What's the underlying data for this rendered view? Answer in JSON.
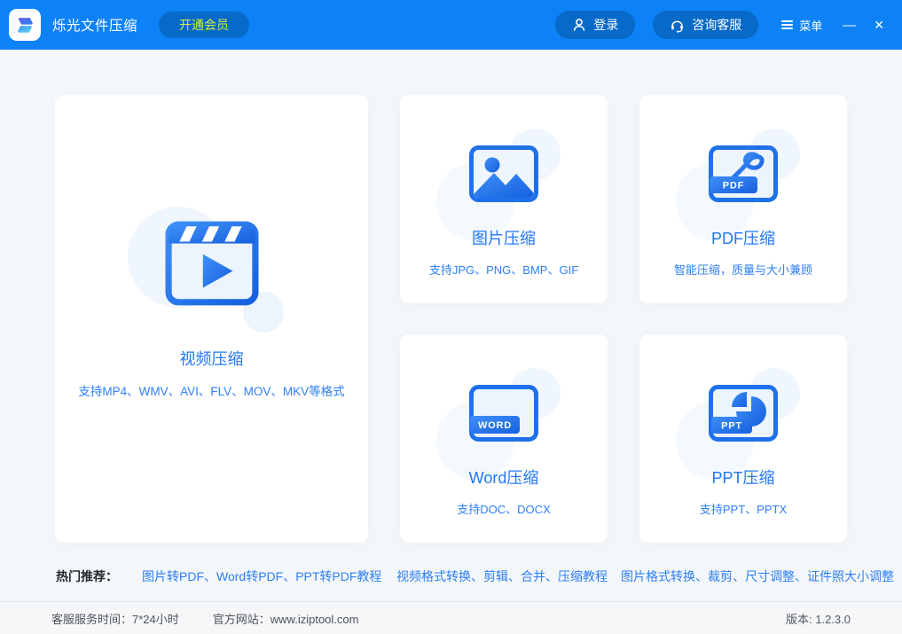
{
  "header": {
    "app_title": "烁光文件压缩",
    "vip_button_label": "开通会员",
    "login_button_label": "登录",
    "support_button_label": "咨询客服",
    "menu_label": "菜单",
    "minimize_glyph": "—",
    "close_glyph": "✕"
  },
  "cards": {
    "video": {
      "title": "视频压缩",
      "subtitle": "支持MP4、WMV、AVI、FLV、MOV、MKV等格式"
    },
    "image": {
      "title": "图片压缩",
      "subtitle": "支持JPG、PNG、BMP、GIF"
    },
    "pdf": {
      "title": "PDF压缩",
      "subtitle": "智能压缩，质量与大小兼顾",
      "badge": "PDF"
    },
    "word": {
      "title": "Word压缩",
      "subtitle": "支持DOC、DOCX",
      "badge": "WORD"
    },
    "ppt": {
      "title": "PPT压缩",
      "subtitle": "支持PPT、PPTX",
      "badge": "PPT"
    }
  },
  "recommendations": {
    "label": "热门推荐：",
    "links": [
      "图片转PDF、Word转PDF、PPT转PDF教程",
      "视频格式转换、剪辑、合并、压缩教程",
      "图片格式转换、裁剪、尺寸调整、证件照大小调整"
    ]
  },
  "footer": {
    "service_time": "客服服务时间：7*24小时",
    "website_label": "官方网站：",
    "website": "www.iziptool.com",
    "version": "版本: 1.2.3.0"
  },
  "colors": {
    "header_blue": "#0d82f7",
    "header_pill_blue": "#0769c8",
    "vip_text_yellow": "#d7ee40",
    "accent_blue": "#2277f3",
    "page_background": "#f4f7f9",
    "card_background": "#ffffff"
  }
}
